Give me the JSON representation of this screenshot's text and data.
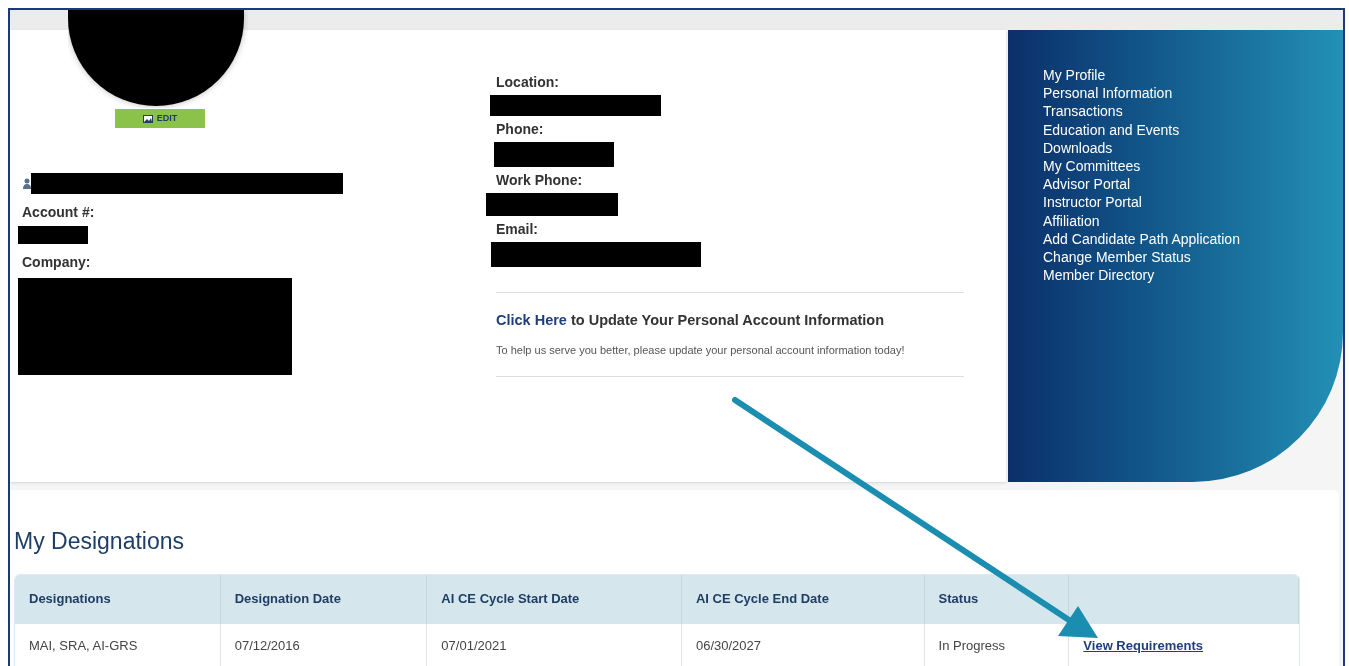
{
  "profile": {
    "edit_button": "EDIT",
    "fields": [
      {
        "label": "Account #:"
      },
      {
        "label": "Company:"
      }
    ]
  },
  "contact": {
    "fields": [
      {
        "label": "Location:"
      },
      {
        "label": "Phone:"
      },
      {
        "label": "Work Phone:"
      },
      {
        "label": "Email:"
      }
    ],
    "update": {
      "link": "Click Here",
      "title": " to Update Your Personal Account Information",
      "note": "To help us serve you better, please update your personal account information today!"
    }
  },
  "nav": {
    "items": [
      "My Profile",
      "Personal Information",
      "Transactions",
      "Education and Events",
      "Downloads",
      "My Committees",
      "Advisor Portal",
      "Instructor Portal",
      "Affiliation",
      "Add Candidate Path Application",
      "Change Member Status",
      "Member Directory"
    ]
  },
  "designations": {
    "title": "My Designations",
    "columns": [
      "Designations",
      "Designation Date",
      "AI CE Cycle Start Date",
      "AI CE Cycle End Date",
      "Status",
      ""
    ],
    "rows": [
      {
        "cells": [
          "MAI, SRA, AI-GRS",
          "07/12/2016",
          "07/01/2021",
          "06/30/2027",
          "In Progress"
        ],
        "link": "View Requirements"
      }
    ]
  }
}
